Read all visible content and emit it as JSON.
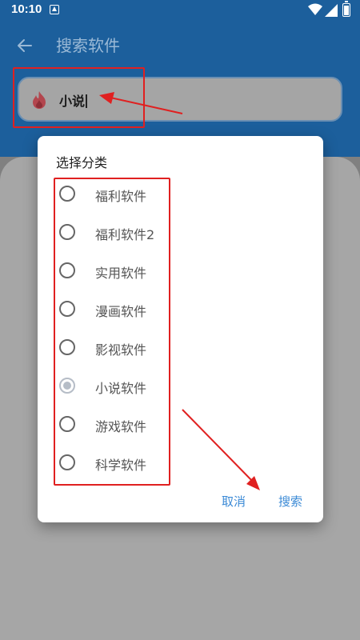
{
  "status_bar": {
    "time": "10:10",
    "notification_icon": "notification-a-icon",
    "wifi_icon": "wifi-icon",
    "signal_icon": "signal-icon",
    "battery_icon": "battery-icon"
  },
  "app_bar": {
    "title": "搜索软件",
    "back_icon": "arrow-back-icon",
    "color": "#1c5f9c"
  },
  "search": {
    "value": "小说",
    "icon": "flame-icon"
  },
  "dialog": {
    "title": "选择分类",
    "options": [
      {
        "label": "福利软件",
        "selected": false
      },
      {
        "label": "福利软件2",
        "selected": false
      },
      {
        "label": "实用软件",
        "selected": false
      },
      {
        "label": "漫画软件",
        "selected": false
      },
      {
        "label": "影视软件",
        "selected": false
      },
      {
        "label": "小说软件",
        "selected": true
      },
      {
        "label": "游戏软件",
        "selected": false
      },
      {
        "label": "科学软件",
        "selected": false
      }
    ],
    "cancel_label": "取消",
    "search_label": "搜索",
    "accent_color": "#3b8ad6"
  },
  "annotation_color": "#e02020"
}
